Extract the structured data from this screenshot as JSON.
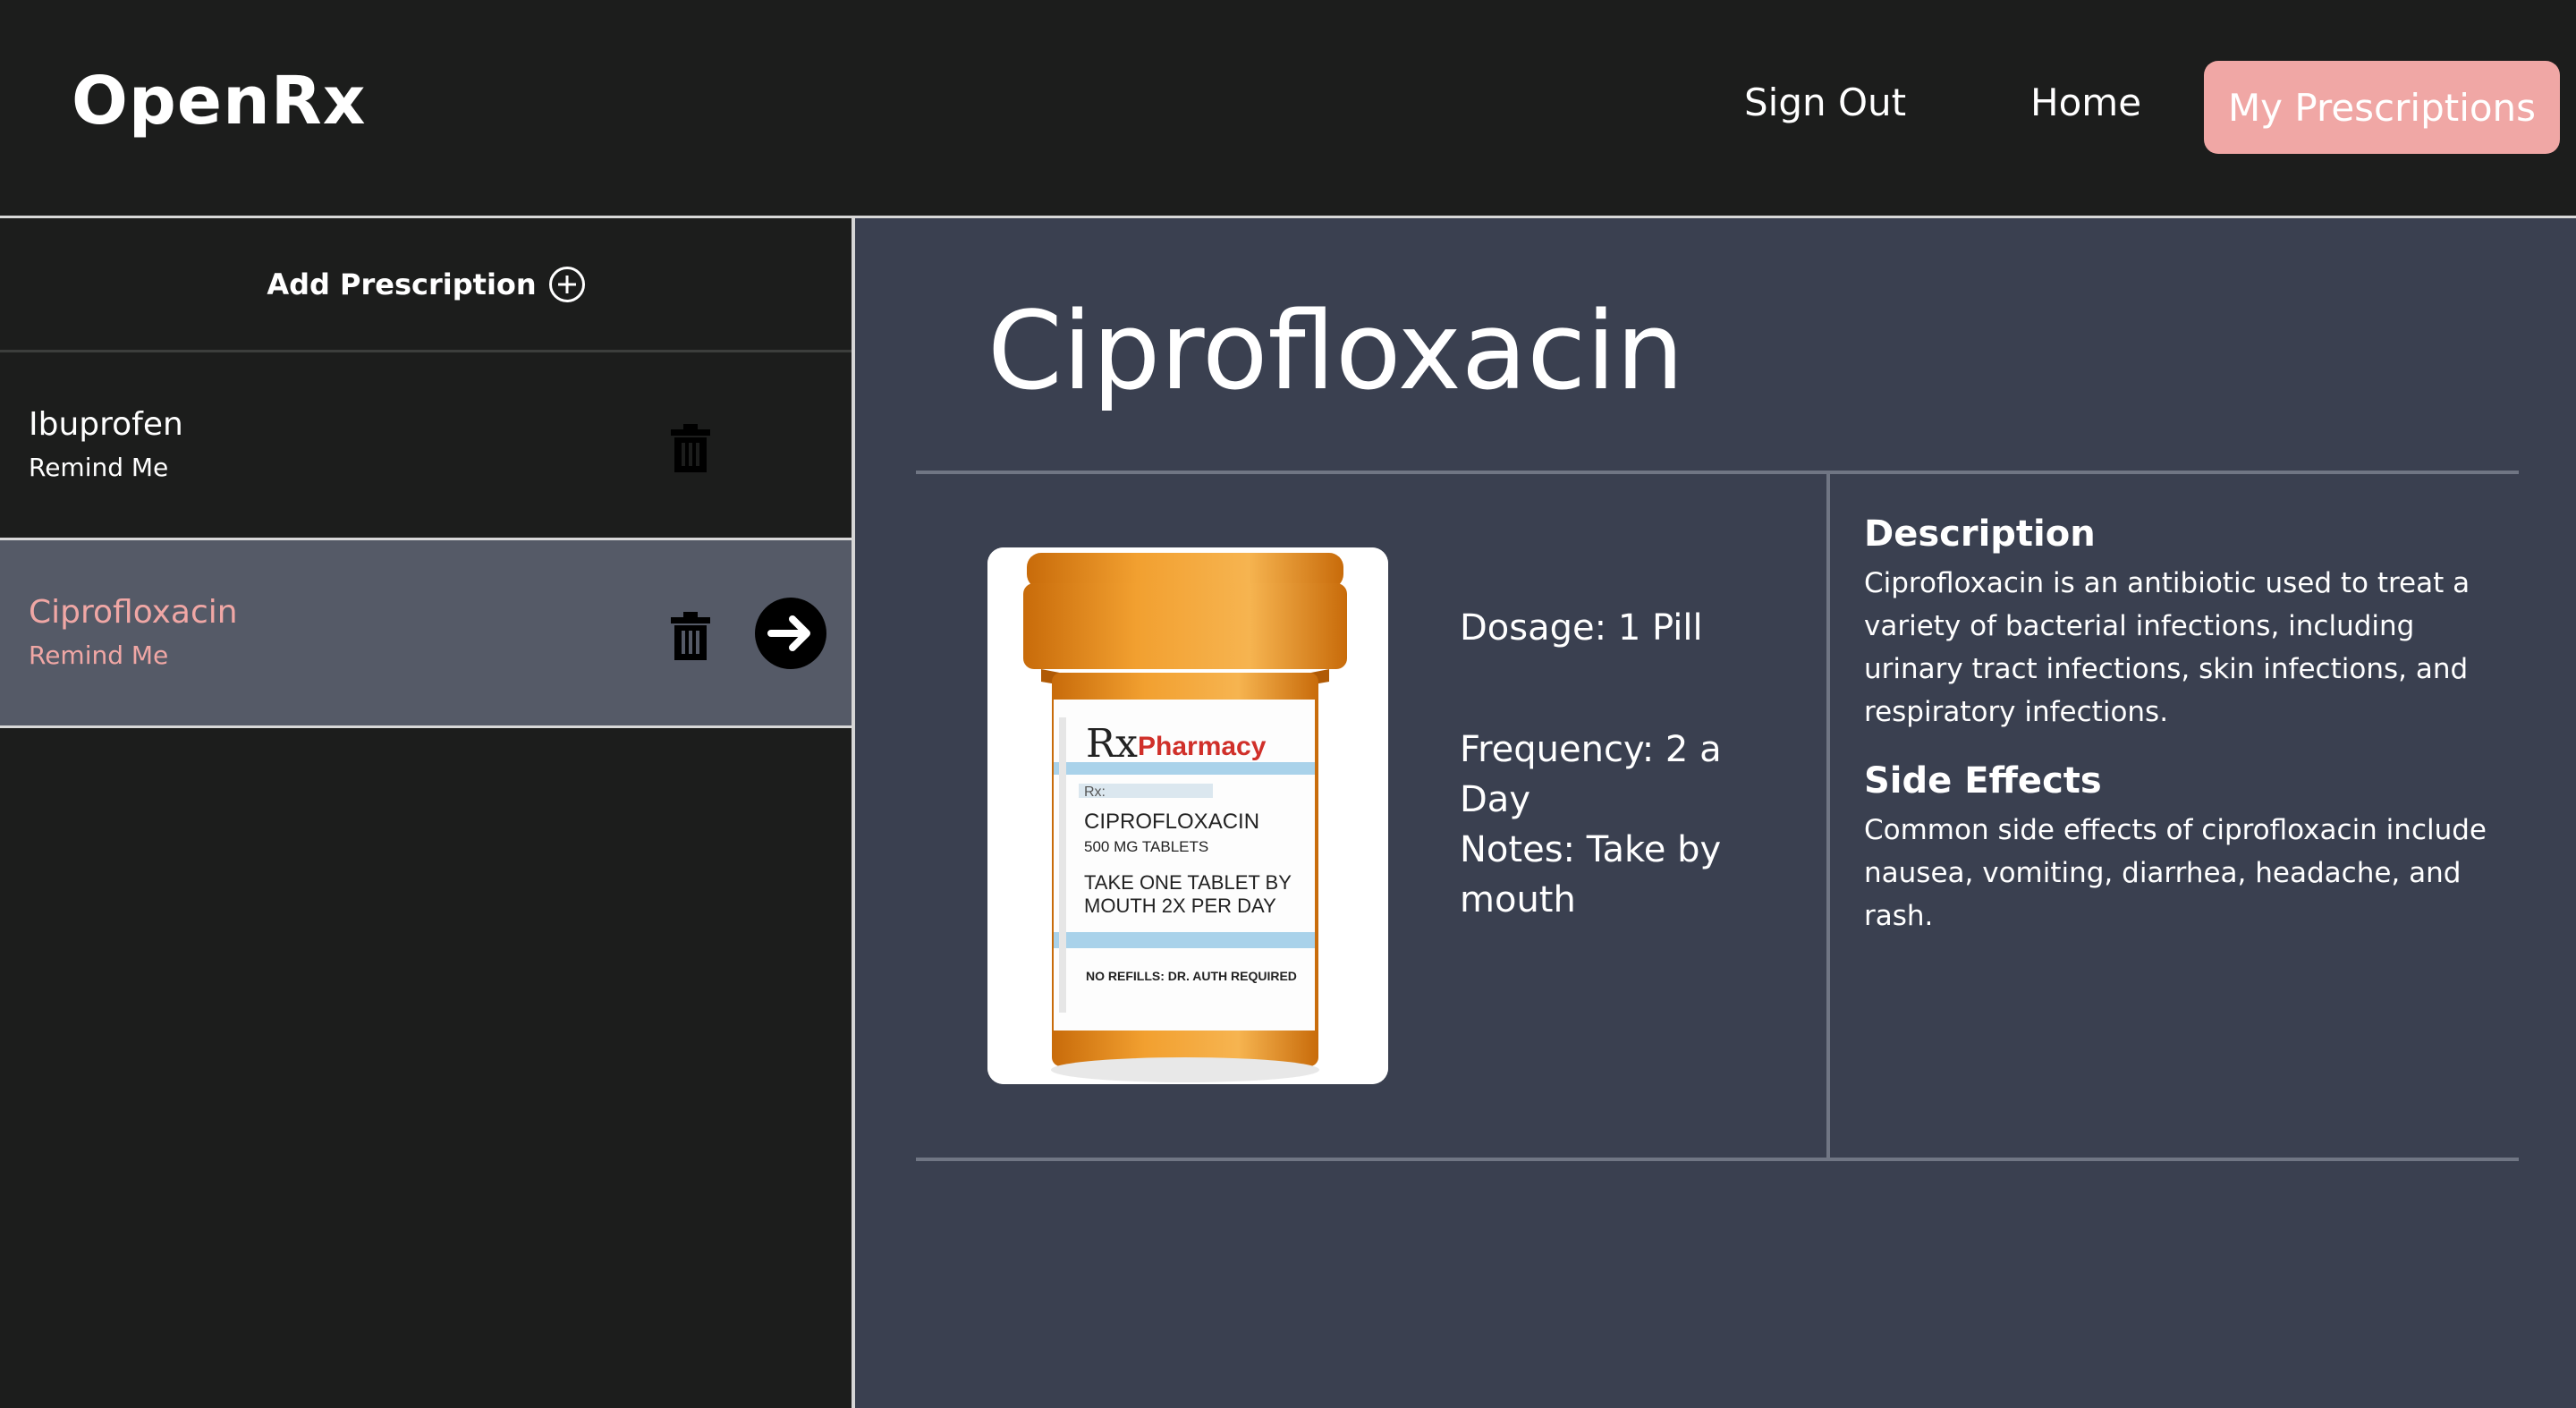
{
  "header": {
    "brand": "OpenRx",
    "nav": {
      "sign_out": "Sign Out",
      "home": "Home",
      "my_prescriptions": "My Prescriptions"
    },
    "accent_color": "#f0a7a5"
  },
  "sidebar": {
    "add_label": "Add Prescription",
    "items": [
      {
        "name": "Ibuprofen",
        "remind": "Remind Me",
        "active": false
      },
      {
        "name": "Ciprofloxacin",
        "remind": "Remind Me",
        "active": true
      }
    ]
  },
  "detail": {
    "title": "Ciprofloxacin",
    "dosage": "Dosage: 1 Pill",
    "frequency": "Frequency: 2 a Day",
    "notes": "Notes: Take by mouth",
    "description_heading": "Description",
    "description_text": "Ciprofloxacin is an antibiotic used to treat a variety of bacterial infections, including urinary tract infections, skin infections, and respiratory infections.",
    "side_effects_heading": "Side Effects",
    "side_effects_text": "Common side effects of ciprofloxacin include nausea, vomiting, diarrhea, headache, and rash.",
    "image_label": {
      "rx_mark": "Rx",
      "pharmacy": "Pharmacy",
      "rx_line": "Rx:",
      "drug": "CIPROFLOXACIN",
      "strength": "500 MG TABLETS",
      "directions_1": "TAKE ONE TABLET BY",
      "directions_2": "MOUTH 2X PER DAY",
      "refills": "NO REFILLS: DR. AUTH REQUIRED"
    }
  }
}
